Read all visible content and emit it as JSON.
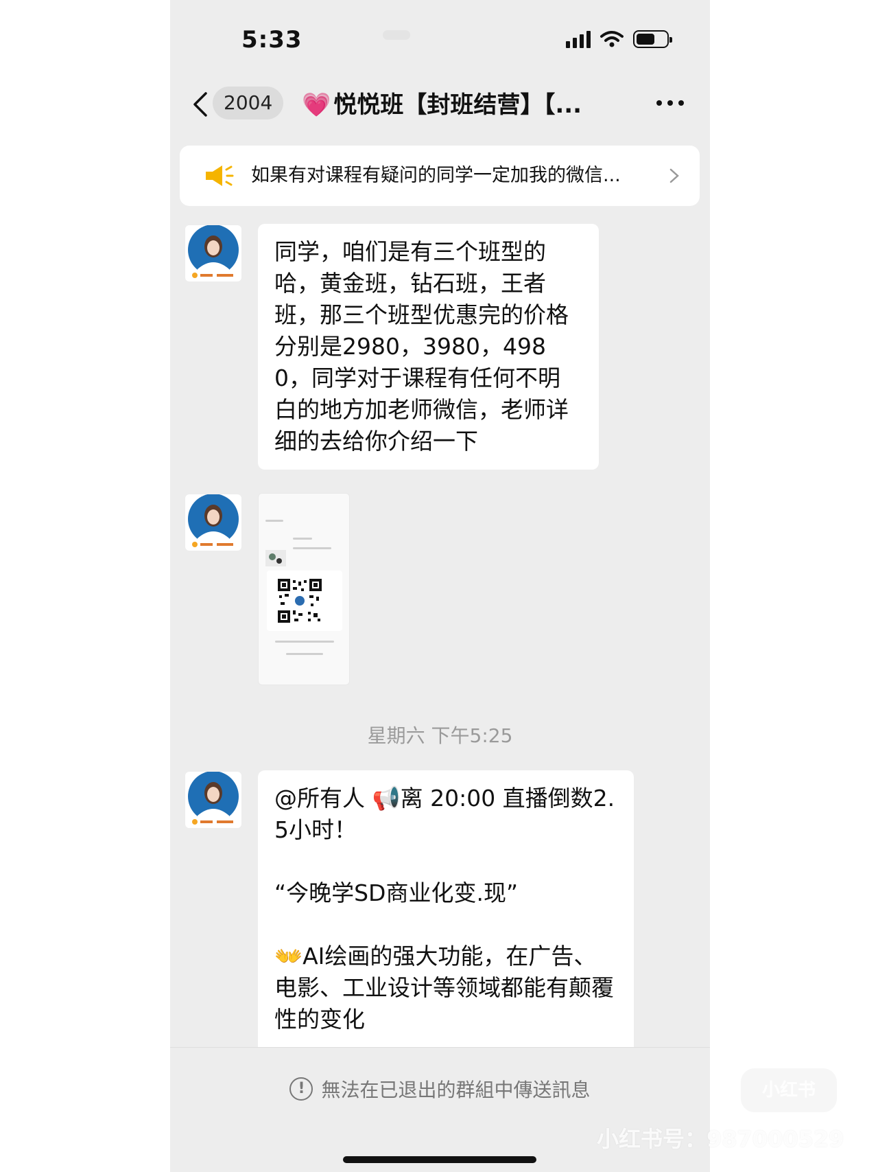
{
  "status_bar": {
    "time": "5:33"
  },
  "nav": {
    "unread_count": "2004",
    "heart_emoji": "💗",
    "title": "悦悦班【封班结营】【..."
  },
  "announcement": {
    "text": "如果有对课程有疑问的同学一定加我的微信..."
  },
  "messages": [
    {
      "type": "text",
      "text": "同学，咱们是有三个班型的哈，黄金班，钻石班，王者班，那三个班型优惠完的价格分别是2980，3980，4980，同学对于课程有任何不明白的地方加老师微信，老师详细的去给你介绍一下"
    },
    {
      "type": "image",
      "image": "qr-code-card"
    },
    {
      "type": "timestamp",
      "text": "星期六 下午5:25"
    },
    {
      "type": "text",
      "line1a": "@所有人 ",
      "emoji_megaphone": "📢",
      "line1b": "离 20:00 直播倒数2.5小时！",
      "line2": "“今晚学SD商业化变.现”",
      "emoji_hands": "👐",
      "line3": "AI绘画的强大功能，在广告、电影、工业设计等领域都能有颠覆性的变化"
    }
  ],
  "footer": {
    "notice": "無法在已退出的群組中傳送訊息"
  },
  "watermark": {
    "text": "小红书号：987000529",
    "logo_text": "小红书"
  },
  "colors": {
    "background": "#ededed",
    "bubble": "#ffffff",
    "heart": "#ff3e96",
    "megaphone": "#f5b400"
  }
}
